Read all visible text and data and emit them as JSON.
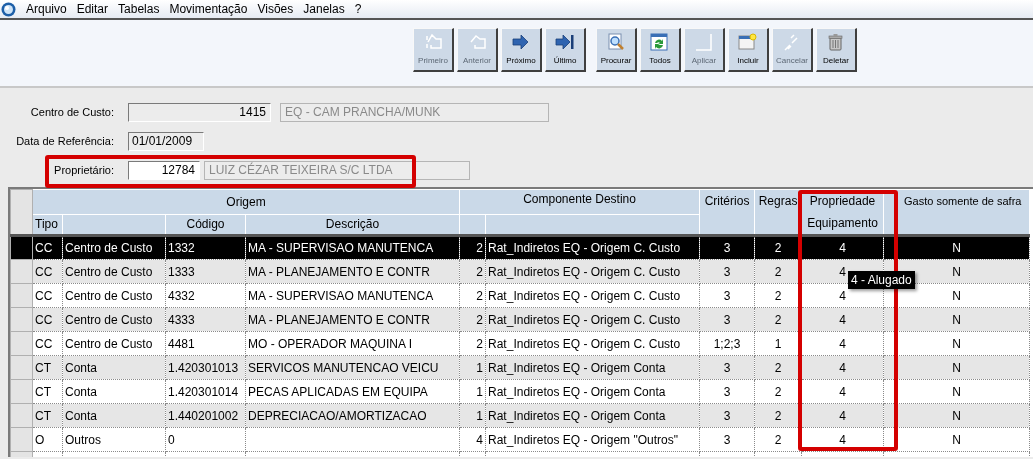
{
  "menu": [
    "Arquivo",
    "Editar",
    "Tabelas",
    "Movimentação",
    "Visões",
    "Janelas",
    "?"
  ],
  "toolbar": [
    {
      "label": "Primeiro",
      "disabled": true
    },
    {
      "label": "Anterior",
      "disabled": true
    },
    {
      "label": "Próximo",
      "disabled": false
    },
    {
      "label": "Último",
      "disabled": false
    },
    {
      "label": "Procurar",
      "disabled": false
    },
    {
      "label": "Todos",
      "disabled": false
    },
    {
      "label": "Aplicar",
      "disabled": true
    },
    {
      "label": "Incluir",
      "disabled": false
    },
    {
      "label": "Cancelar",
      "disabled": true
    },
    {
      "label": "Deletar",
      "disabled": false
    }
  ],
  "form": [
    {
      "label": "Centro de Custo:",
      "kind": "lookup",
      "code": "1415",
      "name": "EQ - CAM PRANCHA/MUNK",
      "editable": false
    },
    {
      "label": "Data de Referência:",
      "kind": "date",
      "code": "01/01/2009",
      "editable": false
    },
    {
      "label": "Proprietário:",
      "kind": "lookup",
      "code": "12784",
      "name": "LUIZ CÉZAR TEIXEIRA S/C LTDA",
      "editable": true
    }
  ],
  "grid": {
    "group_headers": [
      "Origem",
      "Componente Destino"
    ],
    "columns": [
      "Tipo",
      "Código",
      "Descrição",
      "Critérios",
      "Regras",
      "Propriedade Equipamento",
      "Gasto somente de safra"
    ],
    "rows": [
      {
        "selected": true,
        "tipo": "CC",
        "tipo_name": "Centro de Custo",
        "codigo": "1332",
        "descricao": "MA - SUPERVISAO MANUTENCA",
        "comp_id": "2",
        "componente": "Rat_Indiretos EQ - Origem C. Custo",
        "criterios": "3",
        "regras": "2",
        "propriedade": "4",
        "gasto": "N"
      },
      {
        "selected": false,
        "tipo": "CC",
        "tipo_name": "Centro de Custo",
        "codigo": "1333",
        "descricao": "MA - PLANEJAMENTO E CONTR",
        "comp_id": "2",
        "componente": "Rat_Indiretos EQ - Origem C. Custo",
        "criterios": "3",
        "regras": "2",
        "propriedade": "4",
        "gasto": "N"
      },
      {
        "selected": false,
        "tipo": "CC",
        "tipo_name": "Centro de Custo",
        "codigo": "4332",
        "descricao": "MA - SUPERVISAO MANUTENCA",
        "comp_id": "2",
        "componente": "Rat_Indiretos EQ - Origem C. Custo",
        "criterios": "3",
        "regras": "2",
        "propriedade": "4",
        "gasto": "N"
      },
      {
        "selected": false,
        "tipo": "CC",
        "tipo_name": "Centro de Custo",
        "codigo": "4333",
        "descricao": "MA - PLANEJAMENTO E CONTR",
        "comp_id": "2",
        "componente": "Rat_Indiretos EQ - Origem C. Custo",
        "criterios": "3",
        "regras": "2",
        "propriedade": "4",
        "gasto": "N"
      },
      {
        "selected": false,
        "tipo": "CC",
        "tipo_name": "Centro de Custo",
        "codigo": "4481",
        "descricao": "MO - OPERADOR MAQUINA I",
        "comp_id": "2",
        "componente": "Rat_Indiretos EQ - Origem C. Custo",
        "criterios": "1;2;3",
        "regras": "1",
        "propriedade": "4",
        "gasto": "N"
      },
      {
        "selected": false,
        "tipo": "CT",
        "tipo_name": "Conta",
        "codigo": "1.420301013",
        "descricao": "SERVICOS MANUTENCAO VEICU",
        "comp_id": "1",
        "componente": "Rat_Indiretos EQ - Origem Conta",
        "criterios": "3",
        "regras": "2",
        "propriedade": "4",
        "gasto": "N"
      },
      {
        "selected": false,
        "tipo": "CT",
        "tipo_name": "Conta",
        "codigo": "1.420301014",
        "descricao": "PECAS APLICADAS EM EQUIPA",
        "comp_id": "1",
        "componente": "Rat_Indiretos EQ - Origem Conta",
        "criterios": "3",
        "regras": "2",
        "propriedade": "4",
        "gasto": "N"
      },
      {
        "selected": false,
        "tipo": "CT",
        "tipo_name": "Conta",
        "codigo": "1.440201002",
        "descricao": "DEPRECIACAO/AMORTIZACAO",
        "comp_id": "1",
        "componente": "Rat_Indiretos EQ - Origem Conta",
        "criterios": "3",
        "regras": "2",
        "propriedade": "4",
        "gasto": "N"
      },
      {
        "selected": false,
        "tipo": "O",
        "tipo_name": "Outros",
        "codigo": "0",
        "comp_id": "4",
        "componente": "Rat_Indiretos EQ - Origem \"Outros\"",
        "criterios": "3",
        "regras": "2",
        "propriedade": "4",
        "gasto": "N"
      }
    ]
  },
  "tooltip": "4 - Alugado"
}
